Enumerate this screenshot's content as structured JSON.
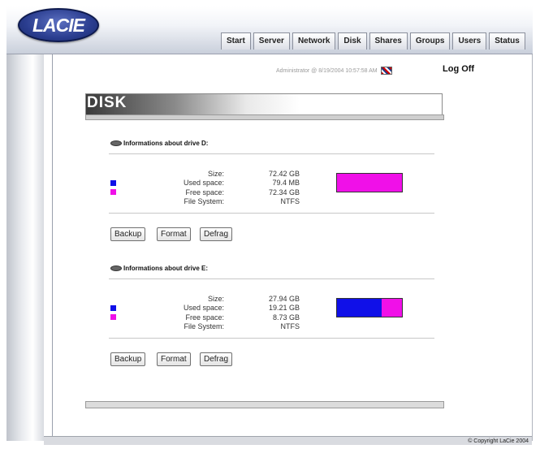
{
  "header": {
    "logo_text": "LACIE"
  },
  "tabs": [
    {
      "label": "Start"
    },
    {
      "label": "Server"
    },
    {
      "label": "Network"
    },
    {
      "label": "Disk"
    },
    {
      "label": "Shares"
    },
    {
      "label": "Groups"
    },
    {
      "label": "Users"
    },
    {
      "label": "Status"
    }
  ],
  "status": {
    "admin_line": "Administrator @ 8/19/2004 10:57:58 AM",
    "logoff_label": "Log Off"
  },
  "page": {
    "title": "DISK"
  },
  "colors": {
    "used": "#1010e8",
    "free": "#f010e8"
  },
  "labels": {
    "size": "Size:",
    "used": "Used space:",
    "free": "Free space:",
    "fs": "File System:"
  },
  "drives": [
    {
      "header": "Informations about drive D:",
      "size": "72.42 GB",
      "used": "79.4 MB",
      "free": "72.34 GB",
      "fs": "NTFS",
      "used_fraction": 0.0
    },
    {
      "header": "Informations about drive E:",
      "size": "27.94 GB",
      "used": "19.21 GB",
      "free": "8.73 GB",
      "fs": "NTFS",
      "used_fraction": 0.69
    }
  ],
  "buttons": {
    "backup": "Backup",
    "format": "Format",
    "defrag": "Defrag"
  },
  "footer": {
    "copyright": "© Copyright LaCie 2004"
  }
}
